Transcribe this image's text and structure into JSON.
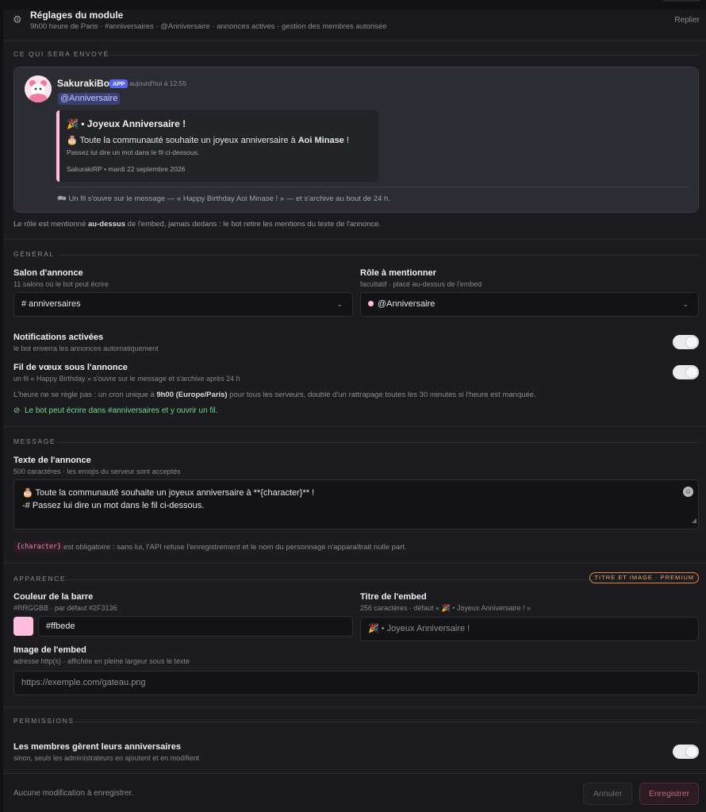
{
  "header": {
    "title": "Réglages du module",
    "subtitle": "9h00 heure de Paris · #anniversaires · @Anniversaire · annonces actives · gestion des membres autorisée",
    "fold_label": "Replier"
  },
  "preview": {
    "section_label": "CE QUI SERA ENVOYÉ",
    "bot_name": "SakurakiBot",
    "app_badge": "APP",
    "time": "aujourd'hui à 12:55",
    "mention": "@Anniversaire",
    "embed": {
      "title": "🎉 • Joyeux Anniversaire !",
      "line_prefix": "🎂 Toute la communauté souhaite un joyeux anniversaire à ",
      "line_name": "Aoi Minase",
      "line_suffix": " !",
      "small": "Passez lui dire un mot dans le fil ci-dessous.",
      "footer": "SakurakiRP • mardi 22 septembre 2026",
      "color": "#ffbede"
    },
    "thread_note": "🗪  Un fil s'ouvre sur le message — « Happy Birthday Aoi Minase ! » — et s'archive au bout de 24 h.",
    "role_note_a": "Le rôle est mentionné ",
    "role_note_b": "au-dessus",
    "role_note_c": " de l'embed, jamais dedans : le bot retire les mentions du texte de l'annonce."
  },
  "general": {
    "section_label": "GÉNÉRAL",
    "channel_label": "Salon d'annonce",
    "channel_hint": "11 salons où le bot peut écrire",
    "channel_value": "# anniversaires",
    "role_label": "Rôle à mentionner",
    "role_hint": "facultatif · placé au-dessus de l'embed",
    "role_value": "@Anniversaire",
    "notif_label": "Notifications activées",
    "notif_hint": "le bot enverra les annonces automatiquement",
    "notif_on": true,
    "thread_label": "Fil de vœux sous l'annonce",
    "thread_hint": "un fil « Happy Birthday » s'ouvre sur le message et s'archive après 24 h",
    "thread_on": true,
    "time_note_a": "L'heure ne se règle pas : un cron unique à ",
    "time_note_b": "9h00 (Europe/Paris)",
    "time_note_c": " pour tous les serveurs, doublé d'un rattrapage toutes les 30 minutes si l'heure est manquée.",
    "ok_text": "Le bot peut écrire dans #anniversaires et y ouvrir un fil."
  },
  "message": {
    "section_label": "MESSAGE",
    "label": "Texte de l'annonce",
    "hint": "500 caractères · les emojis du serveur sont acceptés",
    "line1": "🎂 Toute la communauté souhaite un joyeux anniversaire à **{character}** !",
    "line2": "-# Passez lui dire un mot dans le fil ci-dessous.",
    "code_chip": "{character}",
    "code_note": "est obligatoire : sans lui, l'API refuse l'enregistrement et le nom du personnage n'apparaîtrait nulle part."
  },
  "appearance": {
    "section_label": "APPARENCE",
    "premium_badge": "TITRE ET IMAGE · PREMIUM",
    "color_label": "Couleur de la barre",
    "color_hint": "#RRGGBB · par défaut #2F3136",
    "color_value": "#ffbede",
    "title_label": "Titre de l'embed",
    "title_hint": "256 caractères · défaut « 🎉 • Joyeux Anniversaire ! »",
    "title_placeholder": "🎉 • Joyeux Anniversaire !",
    "image_label": "Image de l'embed",
    "image_hint": "adresse http(s) · affichée en pleine largeur sous le texte",
    "image_placeholder": "https://exemple.com/gateau.png"
  },
  "permissions": {
    "section_label": "PERMISSIONS",
    "members_label": "Les membres gèrent leurs anniversaires",
    "members_hint": "sinon, seuls les administrateurs en ajoutent et en modifient",
    "members_on": true
  },
  "footer": {
    "note": "Aucune modification à enregistrer.",
    "cancel_label": "Annuler",
    "save_label": "Enregistrer"
  }
}
